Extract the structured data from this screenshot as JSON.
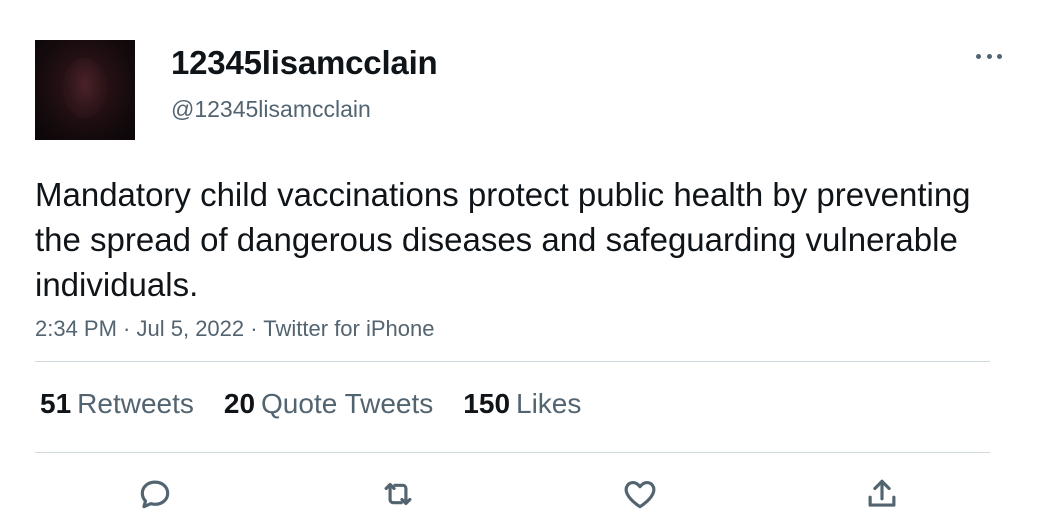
{
  "author": {
    "display_name": "12345lisamcclain",
    "handle": "@12345lisamcclain"
  },
  "tweet": {
    "text": "Mandatory child vaccinations protect public health by preventing the spread of dangerous diseases and safeguarding vulnerable individuals.",
    "time": "2:34 PM",
    "date": "Jul 5, 2022",
    "source": "Twitter for iPhone",
    "meta_separator": " · "
  },
  "stats": {
    "retweets": {
      "count": "51",
      "label": "Retweets"
    },
    "quotes": {
      "count": "20",
      "label": "Quote Tweets"
    },
    "likes": {
      "count": "150",
      "label": "Likes"
    }
  },
  "actions": {
    "reply_icon": "reply-icon",
    "retweet_icon": "retweet-icon",
    "like_icon": "heart-icon",
    "share_icon": "share-icon"
  },
  "colors": {
    "text_primary": "#0f1419",
    "text_secondary": "#536471",
    "divider": "#cfd9de"
  }
}
